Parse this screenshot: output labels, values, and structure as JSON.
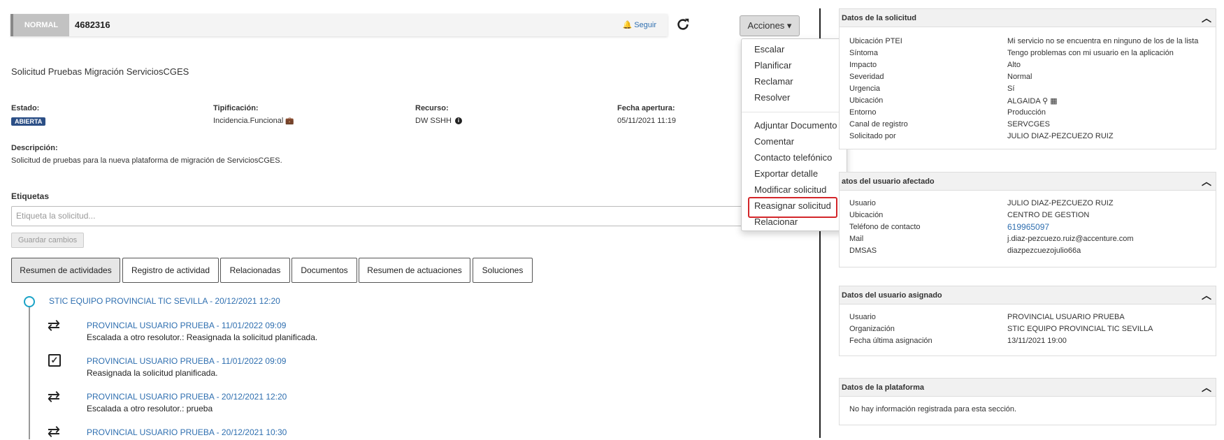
{
  "header": {
    "priority_badge": "NORMAL",
    "ticket_number": "4682316",
    "follow_label": "Seguir",
    "actions_label": "Acciones"
  },
  "request": {
    "title": "Solicitud Pruebas Migración ServiciosCGES",
    "estado_label": "Estado:",
    "estado_value": "ABIERTA",
    "tipificacion_label": "Tipificación:",
    "tipificacion_value": "Incidencia.Funcional",
    "recurso_label": "Recurso:",
    "recurso_value": "DW SSHH",
    "fecha_label": "Fecha apertura:",
    "fecha_value": "05/11/2021 11:19",
    "descripcion_label": "Descripción:",
    "descripcion_value": "Solicitud de pruebas para la nueva plataforma de migración de ServiciosCGES."
  },
  "tags": {
    "label": "Etiquetas",
    "placeholder": "Etiqueta la solicitud...",
    "save_label": "Guardar cambios"
  },
  "tabs": [
    {
      "label": "Resumen de actividades"
    },
    {
      "label": "Registro de actividad"
    },
    {
      "label": "Relacionadas"
    },
    {
      "label": "Documentos"
    },
    {
      "label": "Resumen de actuaciones"
    },
    {
      "label": "Soluciones"
    }
  ],
  "timeline": {
    "group_header": "STIC EQUIPO PROVINCIAL TIC SEVILLA  -  20/12/2021 12:20",
    "entries": [
      {
        "icon": "retweet-icon",
        "head": "PROVINCIAL USUARIO PRUEBA  -  11/01/2022 09:09",
        "text": "Escalada a otro resolutor.: Reasignada la solicitud planificada."
      },
      {
        "icon": "checkbox-icon",
        "head": "PROVINCIAL USUARIO PRUEBA  -  11/01/2022 09:09",
        "text": "Reasignada la solicitud planificada."
      },
      {
        "icon": "retweet-icon",
        "head": "PROVINCIAL USUARIO PRUEBA  -  20/12/2021 12:20",
        "text": "Escalada a otro resolutor.: prueba"
      },
      {
        "icon": "retweet-icon",
        "head": "PROVINCIAL USUARIO PRUEBA  -  20/12/2021 10:30",
        "text": ""
      }
    ]
  },
  "actions_menu": {
    "group1": [
      "Escalar",
      "Planificar",
      "Reclamar",
      "Resolver"
    ],
    "group2": [
      "Adjuntar Documento",
      "Comentar",
      "Contacto telefónico",
      "Exportar detalle",
      "Modificar solicitud",
      "Reasignar solicitud",
      "Relacionar"
    ]
  },
  "panels": {
    "solicitud": {
      "title": "Datos de la solicitud",
      "rows": [
        {
          "k": "Ubicación PTEI",
          "v": "Mi servicio no se encuentra en ninguno de los de la lista"
        },
        {
          "k": "Síntoma",
          "v": "Tengo problemas con mi usuario en la aplicación"
        },
        {
          "k": "Impacto",
          "v": "Alto"
        },
        {
          "k": "Severidad",
          "v": "Normal"
        },
        {
          "k": "Urgencia",
          "v": "Sí"
        },
        {
          "k": "Ubicación",
          "v": "ALGAIDA"
        },
        {
          "k": "Entorno",
          "v": "Producción"
        },
        {
          "k": "Canal de registro",
          "v": "SERVCGES"
        },
        {
          "k": "Solicitado por",
          "v": "JULIO DIAZ-PEZCUEZO RUIZ"
        }
      ]
    },
    "afectado": {
      "title": "atos del usuario afectado",
      "rows": [
        {
          "k": "Usuario",
          "v": "JULIO DIAZ-PEZCUEZO RUIZ"
        },
        {
          "k": "Ubicación",
          "v": "CENTRO DE GESTION"
        },
        {
          "k": "Teléfono de contacto",
          "v": "619965097"
        },
        {
          "k": "Mail",
          "v": "j.diaz-pezcuezo.ruiz@accenture.com"
        },
        {
          "k": "DMSAS",
          "v": "diazpezcuezojulio66a"
        }
      ]
    },
    "asignado": {
      "title": "Datos del usuario asignado",
      "rows": [
        {
          "k": "Usuario",
          "v": "PROVINCIAL USUARIO PRUEBA"
        },
        {
          "k": "Organización",
          "v": "STIC EQUIPO PROVINCIAL TIC SEVILLA"
        },
        {
          "k": "Fecha última asignación",
          "v": "13/11/2021 19:00"
        }
      ]
    },
    "plataforma": {
      "title": "Datos de la plataforma",
      "empty_text": "No hay información registrada para esta sección."
    }
  },
  "colors": {
    "link_blue": "#2f6fb0",
    "badge_blue": "#2c4f86",
    "timeline_teal": "#1aa3c7",
    "highlight_red": "#d3262a"
  }
}
